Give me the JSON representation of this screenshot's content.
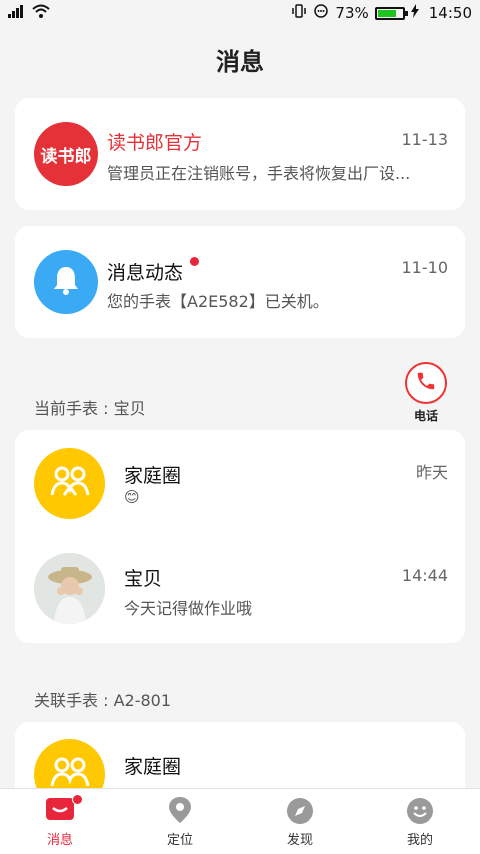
{
  "status_bar": {
    "battery_percent": "73%",
    "battery_level": 0.73,
    "time": "14:50"
  },
  "header": {
    "title": "消息"
  },
  "official": {
    "logo_text": "读书郎",
    "name": "读书郎官方",
    "date": "11-13",
    "preview": "管理员正在注销账号，手表将恢复出厂设..."
  },
  "notifications": {
    "name": "消息动态",
    "date": "11-10",
    "preview": "您的手表【A2E582】已关机。"
  },
  "current_watch": {
    "label": "当前手表 : 宝贝",
    "call_label": "电话",
    "items": [
      {
        "name": "家庭圈",
        "time": "昨天",
        "preview": "😊"
      },
      {
        "name": "宝贝",
        "time": "14:44",
        "preview": "今天记得做作业哦"
      }
    ]
  },
  "linked_watch": {
    "label": "关联手表 : A2-801",
    "items": [
      {
        "name": "家庭圈"
      }
    ]
  },
  "tabs": [
    {
      "label": "消息",
      "icon": "message-icon",
      "active": true
    },
    {
      "label": "定位",
      "icon": "location-pin-icon"
    },
    {
      "label": "发现",
      "icon": "compass-icon"
    },
    {
      "label": "我的",
      "icon": "smile-face-icon"
    }
  ],
  "colors": {
    "accent_red": "#e8253a",
    "official_red": "#e53238",
    "bell_blue": "#3aaaf4",
    "family_yellow": "#ffc800"
  }
}
